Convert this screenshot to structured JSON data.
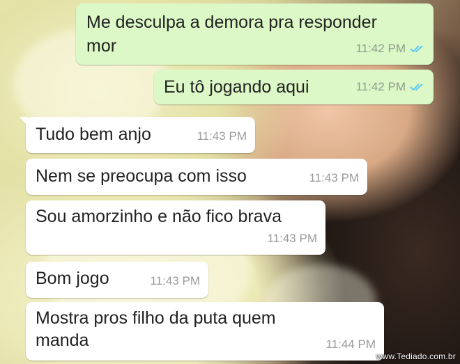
{
  "chat": {
    "messages": [
      {
        "text_lines": [
          "Me desculpa a demora pra responder",
          "mor"
        ],
        "time": "11:42 PM"
      },
      {
        "text_lines": [
          "Eu tô jogando aqui"
        ],
        "time": "11:42 PM"
      },
      {
        "text_lines": [
          "Tudo bem anjo"
        ],
        "time": "11:43 PM"
      },
      {
        "text_lines": [
          "Nem se preocupa com isso"
        ],
        "time": "11:43 PM"
      },
      {
        "text_lines": [
          "Sou amorzinho e não fico brava"
        ],
        "time": "11:43 PM"
      },
      {
        "text_lines": [
          "Bom jogo"
        ],
        "time": "11:43 PM"
      },
      {
        "text_lines": [
          "Mostra pros filho da puta quem",
          "manda"
        ],
        "time": "11:44 PM"
      }
    ],
    "colors": {
      "outgoing_bubble": "#dcf8c6",
      "incoming_bubble": "#ffffff",
      "read_ticks": "#4fc3f7"
    },
    "icons": {
      "read_receipt": "double-check-icon"
    }
  },
  "watermark": "www.Tediado.com.br"
}
